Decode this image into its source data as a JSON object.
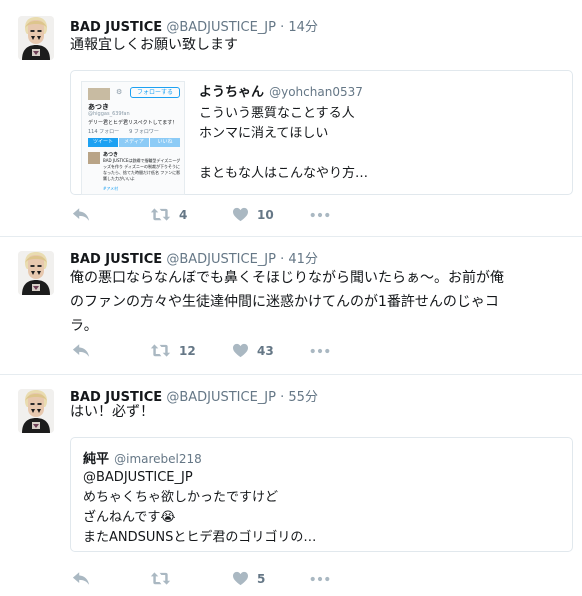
{
  "tweets": [
    {
      "name": "BAD JUSTICE",
      "handle": "@BADJUSTICE_JP",
      "dot": "·",
      "time": "14分",
      "text": "通報宜しくお願い致します",
      "quote": {
        "name": "ようちゃん",
        "handle": "@yohchan0537",
        "lines": [
          "こういう悪質なことする人",
          "ホンマに消えてほしい",
          "",
          "まともな人はこんなやり方…"
        ],
        "card": {
          "follow_label": "フォローする",
          "profile_name": "あつき",
          "profile_handle": "@higgas_639fan",
          "bio": "デリー君とヒデ君リスペクトしてます！",
          "stats": "114 フォロー　　9 フォロワー",
          "tabs": [
            "ツイート",
            "メディア",
            "いいね"
          ],
          "inner_name": "あつき",
          "inner_text": "BAD JUSTICEは鉄綱で指輪型デイズニーグッズを作り ディズニーの制裁が下りそうになったら、捨てた時間だけ低名 ファンに影響した力がいいよ",
          "inner_tag": "#アメ村"
        }
      },
      "actions": {
        "retweets": "4",
        "likes": "10"
      }
    },
    {
      "name": "BAD JUSTICE",
      "handle": "@BADJUSTICE_JP",
      "dot": "·",
      "time": "41分",
      "lines": [
        "俺の悪口ならなんぼでも鼻くそほじりながら聞いたらぁ〜。お前が俺",
        "のファンの方々や生徒達仲間に迷惑かけてんのが1番許せんのじゃコ",
        "ラ。"
      ],
      "actions": {
        "retweets": "12",
        "likes": "43"
      }
    },
    {
      "name": "BAD JUSTICE",
      "handle": "@BADJUSTICE_JP",
      "dot": "·",
      "time": "55分",
      "text": "はい！必ず！",
      "quote": {
        "name": "純平",
        "handle": "@imarebel218",
        "lines": [
          "@BADJUSTICE_JP",
          "めちゃくちゃ欲しかったですけど",
          "ざんねんです😭",
          "またANDSUNSとヒデ君のゴリゴリの…"
        ]
      },
      "actions": {
        "retweets": "",
        "likes": "5"
      }
    }
  ],
  "icons": [
    "reply-icon",
    "retweet-icon",
    "heart-icon",
    "more-icon"
  ],
  "colors": {
    "icon": "#aab8c2",
    "count": "#657786",
    "name": "#14171a",
    "secondary": "#657786",
    "border": "#e1e8ed",
    "card_blue": "#1da1f2",
    "heart_bg": "#aab8c2"
  }
}
